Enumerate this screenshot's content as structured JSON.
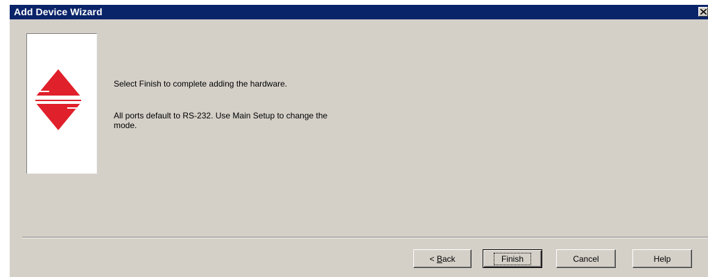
{
  "window": {
    "title": "Add Device Wizard"
  },
  "content": {
    "message_line1": "Select Finish to complete adding the hardware.",
    "message_line2": "All ports default to RS-232.  Use Main Setup to change the mode."
  },
  "buttons": {
    "back_prefix": "< ",
    "back_mnemonic": "B",
    "back_rest": "ack",
    "finish": "Finish",
    "cancel": "Cancel",
    "help": "Help"
  },
  "colors": {
    "titlebar": "#0a246a",
    "dialog_bg": "#d4d0c8",
    "logo_red": "#e0202a"
  },
  "icons": {
    "close": "close-icon",
    "logo": "wizard-logo-icon"
  }
}
